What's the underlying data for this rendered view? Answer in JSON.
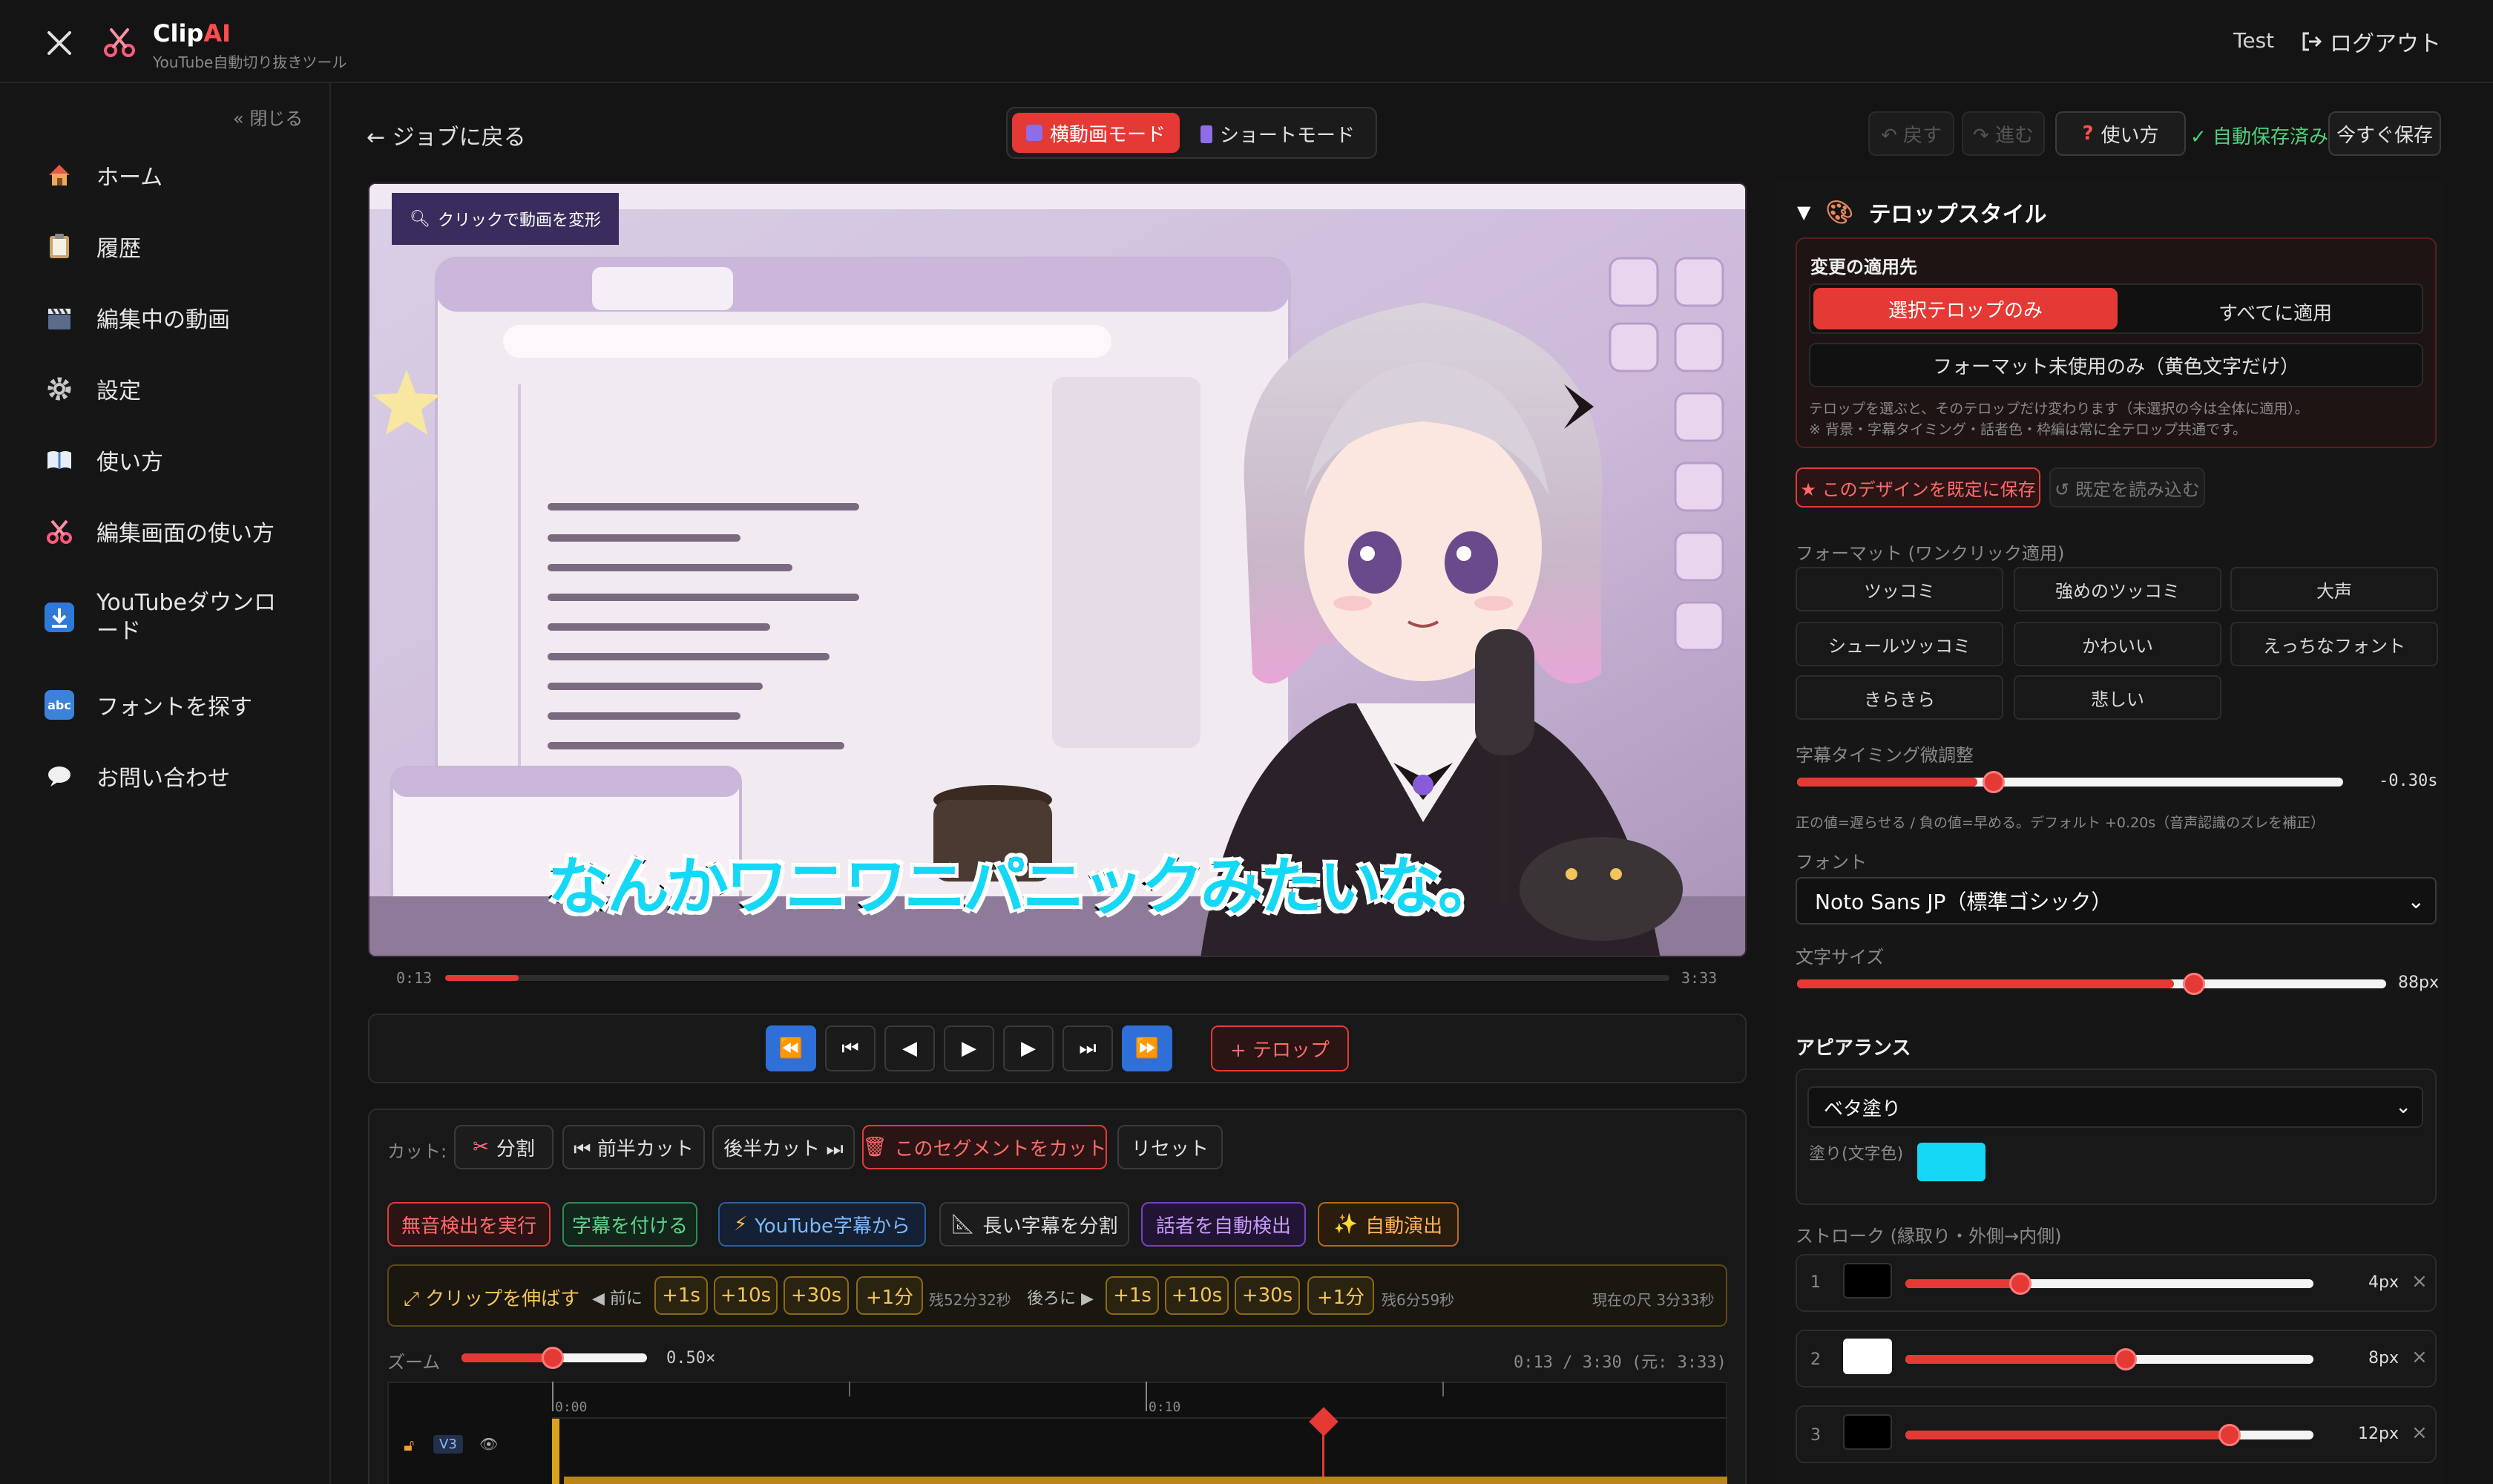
{
  "header": {
    "app_name": "ClipAI",
    "app_name_accent": "AI",
    "tagline": "YouTube自動切り抜きツール",
    "user": "Test",
    "logout": "ログアウト"
  },
  "sidebar": {
    "collapse": "« 閉じる",
    "items": [
      {
        "label": "ホーム",
        "icon": "home-icon"
      },
      {
        "label": "履歴",
        "icon": "clipboard-icon"
      },
      {
        "label": "編集中の動画",
        "icon": "clapper-icon"
      },
      {
        "label": "設定",
        "icon": "gear-icon"
      },
      {
        "label": "使い方",
        "icon": "book-icon"
      },
      {
        "label": "編集画面の使い方",
        "icon": "scissors-icon"
      },
      {
        "label": "YouTubeダウンロード",
        "icon": "download-icon"
      },
      {
        "label": "フォントを探す",
        "icon": "abc-icon"
      },
      {
        "label": "お問い合わせ",
        "icon": "speech-bubble-icon"
      }
    ]
  },
  "topbar": {
    "back": "← ジョブに戻る",
    "mode_landscape": "横動画モード",
    "mode_short": "ショートモード",
    "undo": "↶ 戻す",
    "redo": "↷ 進む",
    "help": "使い方",
    "autosaved": "✓ 自動保存済み",
    "save_now": "今すぐ保存"
  },
  "video": {
    "hint": "クリックで動画を変形",
    "subtitle": "なんかワニワニパニックみたいな。",
    "time_current": "0:13",
    "time_total": "3:33",
    "progress": 0.06
  },
  "controls": {
    "add_telop": "+ テロップ"
  },
  "cut": {
    "label": "カット:",
    "split": "分割",
    "cut_front": "⏮ 前半カット",
    "cut_back": "後半カット ⏭",
    "cut_segment": "このセグメントをカット",
    "reset": "リセット"
  },
  "actions": {
    "silence": "無音検出を実行",
    "add_subs": "字幕を付ける",
    "yt_subs": "YouTube字幕から",
    "split_long": "長い字幕を分割",
    "speakers": "話者を自動検出",
    "auto_fx": "自動演出"
  },
  "extend": {
    "label": "⤢ クリップを伸ばす",
    "before": "◀ 前に",
    "after": "後ろに ▶",
    "before_buttons": [
      "+1s",
      "+10s",
      "+30s",
      "+1分"
    ],
    "before_remaining": "残52分32秒",
    "after_buttons": [
      "+1s",
      "+10s",
      "+30s",
      "+1分"
    ],
    "after_remaining": "残6分59秒",
    "current": "現在の尺 3分33秒"
  },
  "zoom": {
    "label": "ズーム",
    "value": "0.50×",
    "level": 0.5,
    "timecode": "0:13 / 3:30 (元: 3:33)"
  },
  "timeline": {
    "tick1": "0:00",
    "tick2": "0:10",
    "track": "V3"
  },
  "panel": {
    "title": "テロップスタイル",
    "apply_title": "変更の適用先",
    "apply_selected": "選択テロップのみ",
    "apply_all": "すべてに適用",
    "apply_unformatted": "フォーマット未使用のみ（黄色文字だけ）",
    "apply_note1": "テロップを選ぶと、そのテロップだけ変わります（未選択の今は全体に適用）。",
    "apply_note2": "※ 背景・字幕タイミング・話者色・枠編は常に全テロップ共通です。",
    "save_default": "★ このデザインを既定に保存",
    "load_default": "↺ 既定を読み込む",
    "format_title": "フォーマット (ワンクリック適用)",
    "formats": [
      "ツッコミ",
      "強めのツッコミ",
      "大声",
      "シュールツッコミ",
      "かわいい",
      "えっちなフォント",
      "きらきら",
      "悲しい"
    ],
    "timing_title": "字幕タイミング微調整",
    "timing_value": "-0.30s",
    "timing_note": "正の値=遅らせる / 負の値=早める。デフォルト +0.20s（音声認識のズレを補正）",
    "font_title": "フォント",
    "font_value": "Noto Sans JP（標準ゴシック）",
    "size_title": "文字サイズ",
    "size_value": "88px",
    "appearance_title": "アピアランス",
    "appearance_value": "ベタ塗り",
    "fill_label": "塗り(文字色)",
    "fill_color": "#14d8f5",
    "stroke_title": "ストローク (縁取り・外側→内側)",
    "strokes": [
      {
        "index": "1",
        "value": "4px",
        "color": "#000000"
      },
      {
        "index": "2",
        "value": "8px",
        "color": "#ffffff"
      },
      {
        "index": "3",
        "value": "12px",
        "color": "#000000"
      }
    ]
  },
  "colors": {
    "accent": "#e53935",
    "bg": "#141414"
  }
}
